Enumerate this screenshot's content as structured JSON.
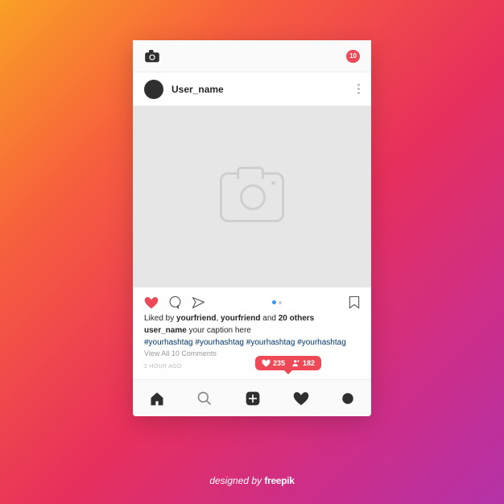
{
  "topbar": {
    "notification_count": "10"
  },
  "post": {
    "username": "User_name",
    "caption_username": "user_name",
    "caption_text": "your caption here",
    "hashtags": [
      "#yourhashtag",
      "#yourhashtag",
      "#yourhashtag",
      "#yourhashtag"
    ],
    "liked_by_prefix": "Liked by ",
    "liked_by_friend1": "yourfriend",
    "liked_by_sep": ", ",
    "liked_by_friend2": "yourfriend",
    "liked_by_and": " and ",
    "liked_by_others": "20 others",
    "view_comments": "View All 10 Comments",
    "timestamp": "2 HOUR AGO"
  },
  "notif": {
    "likes": "235",
    "followers": "182"
  },
  "attribution": {
    "prefix": "designed by ",
    "brand": "freepik"
  },
  "colors": {
    "like_red": "#ed4956",
    "link_blue": "#00376b"
  }
}
